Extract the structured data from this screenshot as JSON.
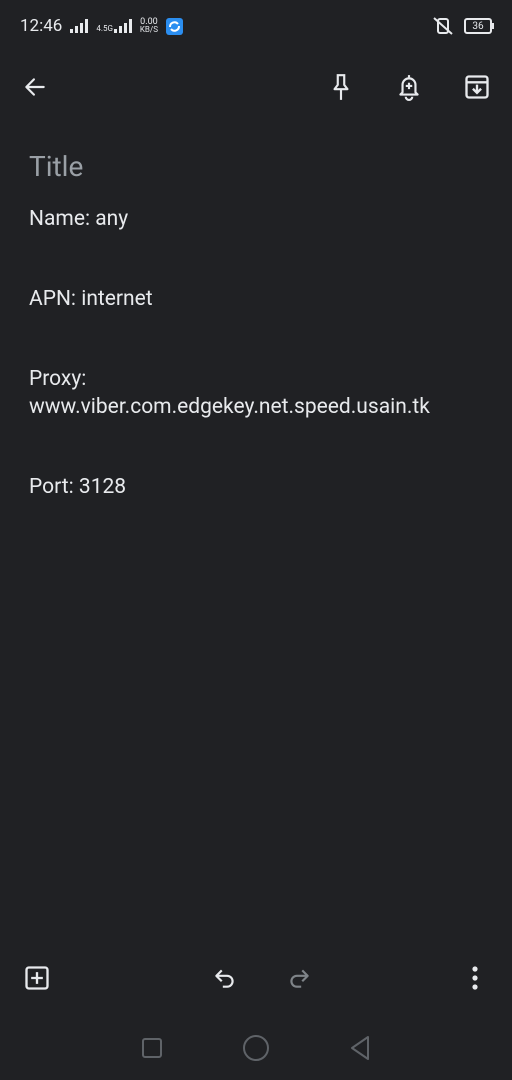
{
  "status": {
    "time": "12:46",
    "network_type": "4.5G",
    "speed_value": "0.00",
    "speed_unit": "KB/S",
    "battery": "36"
  },
  "note": {
    "title_placeholder": "Title",
    "lines": [
      "Name: any",
      "APN: internet",
      "Proxy: www.viber.com.edgekey.net.speed.usain.tk",
      "Port: 3128"
    ]
  },
  "icons": {
    "back": "arrow-left-icon",
    "pin": "pin-icon",
    "reminder": "bell-plus-icon",
    "archive": "archive-icon",
    "add": "add-box-icon",
    "undo": "undo-icon",
    "redo": "redo-icon",
    "more": "more-vert-icon"
  }
}
